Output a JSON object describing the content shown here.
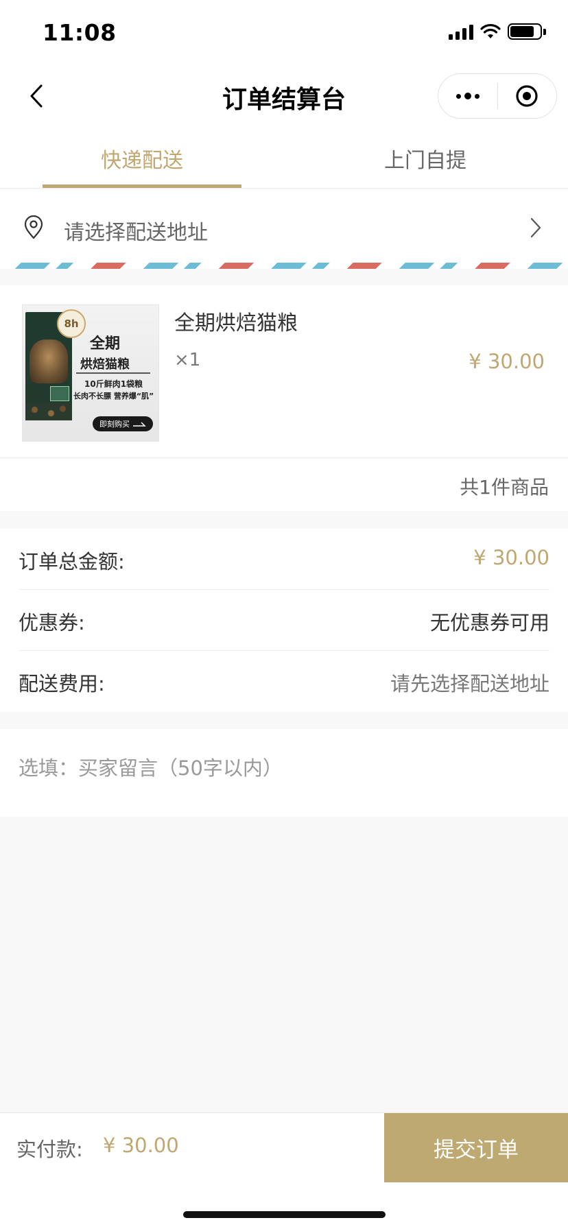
{
  "status_bar": {
    "time": "11:08"
  },
  "nav": {
    "title": "订单结算台"
  },
  "tabs": [
    {
      "label": "快递配送",
      "active": true
    },
    {
      "label": "上门自提",
      "active": false
    }
  ],
  "address": {
    "placeholder": "请选择配送地址"
  },
  "product": {
    "name": "全期烘焙猫粮",
    "quantity": "×1",
    "price": "¥ 30.00",
    "image_text": {
      "badge": "8h",
      "heading1": "全期",
      "heading2": "烘焙猫粮",
      "line1": "10斤鲜肉1袋粮",
      "line2": "长肉不长膘 营养爆“肌”",
      "buy": "即刻购买"
    }
  },
  "item_count": "共1件商品",
  "summary": {
    "total_label": "订单总金额:",
    "total_value": "¥ 30.00",
    "coupon_label": "优惠券:",
    "coupon_value": "无优惠券可用",
    "shipping_label": "配送费用:",
    "shipping_value": "请先选择配送地址"
  },
  "message": {
    "placeholder": "选填：买家留言（50字以内）",
    "value": ""
  },
  "bottom_bar": {
    "pay_label": "实付款:",
    "pay_amount": "¥ 30.00",
    "submit_label": "提交订单"
  },
  "colors": {
    "accent": "#c0a772",
    "submit_bg": "#bfa972",
    "stripe_blue": "#6cbcd6",
    "stripe_red": "#d96c60"
  },
  "icons": [
    "back-chevron-icon",
    "more-dots-icon",
    "record-target-icon",
    "location-pin-icon",
    "chevron-right-icon",
    "signal-icon",
    "wifi-icon",
    "battery-icon"
  ]
}
